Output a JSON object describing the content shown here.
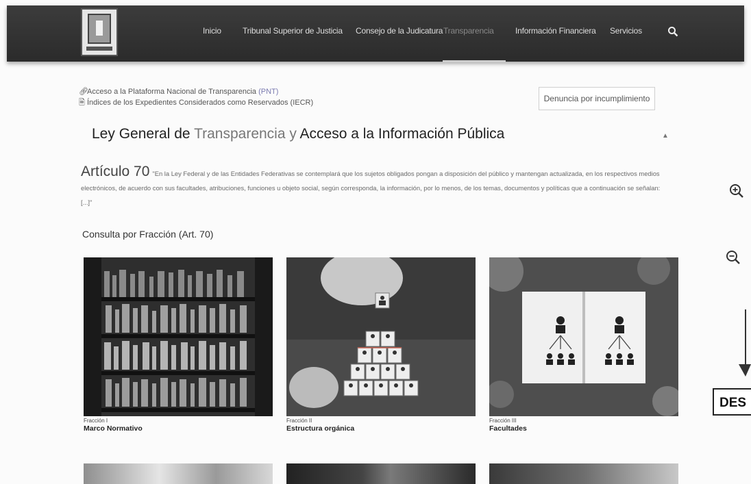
{
  "nav": {
    "items": [
      {
        "label": "Inicio"
      },
      {
        "label": "Tribunal Superior de Justicia"
      },
      {
        "label": "Consejo de la Judicatura"
      },
      {
        "label": "Transparencia"
      },
      {
        "label": "Información Financiera"
      },
      {
        "label": "Servicios"
      }
    ],
    "active": "Transparencia",
    "search_icon": "search-icon"
  },
  "links": {
    "pnt_prefix": "Acceso a la Plataforma Nacional de Transparencia",
    "pnt_abbr": "(PNT)",
    "iecr": "Índices de los Expedientes Considerados como Reservados (IECR)"
  },
  "denuncia_label": "Denuncia por incumplimiento",
  "law": {
    "title_a": "Ley General de ",
    "title_b": "Transparencia y",
    "title_c": " Acceso a la Información Pública"
  },
  "articulo": {
    "heading": "Artículo 70",
    "text": "\"En la Ley Federal y de las Entidades Federativas se contemplará que los sujetos obligados pongan a disposición del público y mantengan actualizada, en los respectivos medios electrónicos, de acuerdo con sus facultades, atribuciones, funciones u objeto social, según corresponda, la información, por lo menos, de los temas, documentos y políticas que a continuación se señalan: [...]\""
  },
  "consulta_heading": "Consulta por Fracción (Art. 70)",
  "cards": [
    {
      "fraccion": "Fracción I",
      "name": "Marco Normativo"
    },
    {
      "fraccion": "Fracción II",
      "name": "Estructura orgánica"
    },
    {
      "fraccion": "Fracción III",
      "name": "Facultades"
    }
  ],
  "side": {
    "des_label": "DES"
  }
}
